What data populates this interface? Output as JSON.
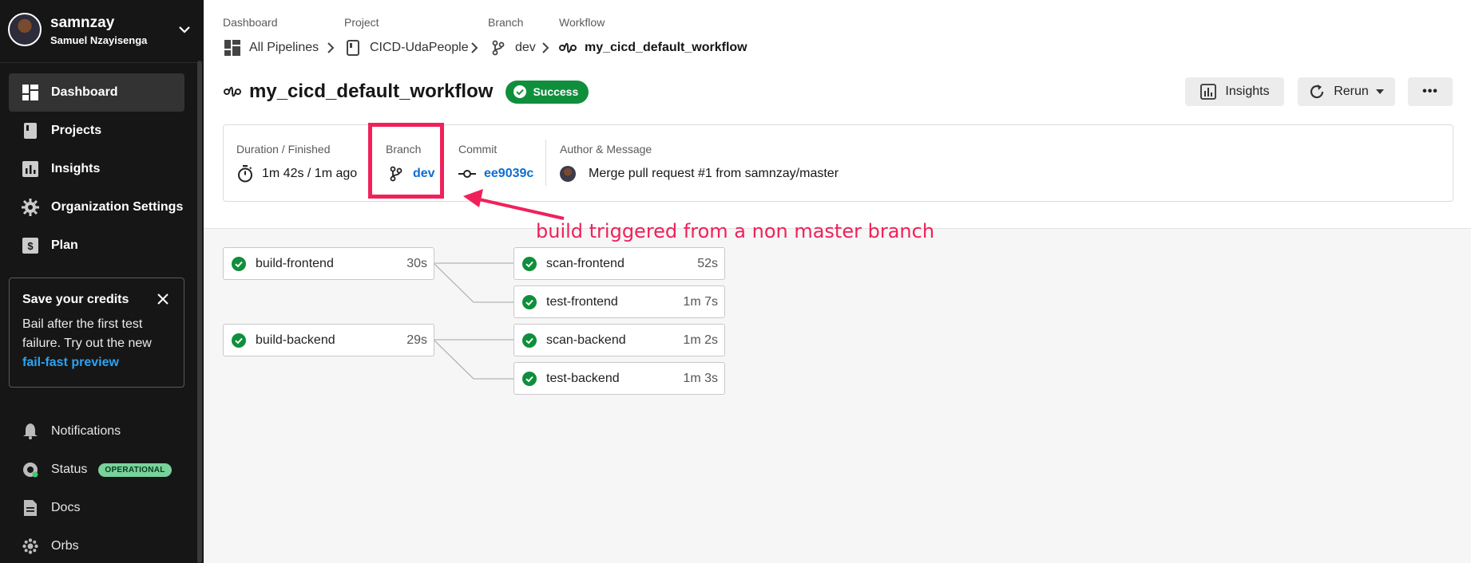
{
  "account": {
    "username": "samnzay",
    "full_name": "Samuel Nzayisenga"
  },
  "nav": {
    "items": [
      {
        "label": "Dashboard",
        "icon": "dashboard-icon"
      },
      {
        "label": "Projects",
        "icon": "projects-icon"
      },
      {
        "label": "Insights",
        "icon": "insights-icon"
      },
      {
        "label": "Organization Settings",
        "icon": "gear-icon"
      },
      {
        "label": "Plan",
        "icon": "plan-icon"
      }
    ],
    "bottom": [
      {
        "label": "Notifications",
        "icon": "bell-icon"
      },
      {
        "label": "Status",
        "icon": "status-icon",
        "badge": "OPERATIONAL"
      },
      {
        "label": "Docs",
        "icon": "docs-icon"
      },
      {
        "label": "Orbs",
        "icon": "orbs-icon"
      }
    ]
  },
  "promo": {
    "title": "Save your credits",
    "body": "Bail after the first test failure. Try out the new",
    "link": "fail-fast preview"
  },
  "breadcrumb": {
    "labels": [
      "Dashboard",
      "Project",
      "Branch",
      "Workflow"
    ],
    "values": [
      "All Pipelines",
      "CICD-UdaPeople",
      "dev",
      "my_cicd_default_workflow"
    ]
  },
  "header": {
    "title": "my_cicd_default_workflow",
    "status": "Success",
    "insights_label": "Insights",
    "rerun_label": "Rerun",
    "more_label": "•••"
  },
  "meta": {
    "duration_label": "Duration / Finished",
    "duration_value": "1m 42s / 1m ago",
    "branch_label": "Branch",
    "branch_value": "dev",
    "commit_label": "Commit",
    "commit_value": "ee9039c",
    "author_label": "Author & Message",
    "message": "Merge pull request #1 from samnzay/master"
  },
  "annotation": "build triggered from a non master branch",
  "jobs": [
    {
      "name": "build-frontend",
      "duration": "30s"
    },
    {
      "name": "scan-frontend",
      "duration": "52s"
    },
    {
      "name": "test-frontend",
      "duration": "1m 7s"
    },
    {
      "name": "build-backend",
      "duration": "29s"
    },
    {
      "name": "scan-backend",
      "duration": "1m 2s"
    },
    {
      "name": "test-backend",
      "duration": "1m 3s"
    }
  ],
  "colors": {
    "success": "#0f8f3c",
    "annotation": "#f0215a",
    "link": "#0d6ed1",
    "sidebar": "#161616"
  }
}
